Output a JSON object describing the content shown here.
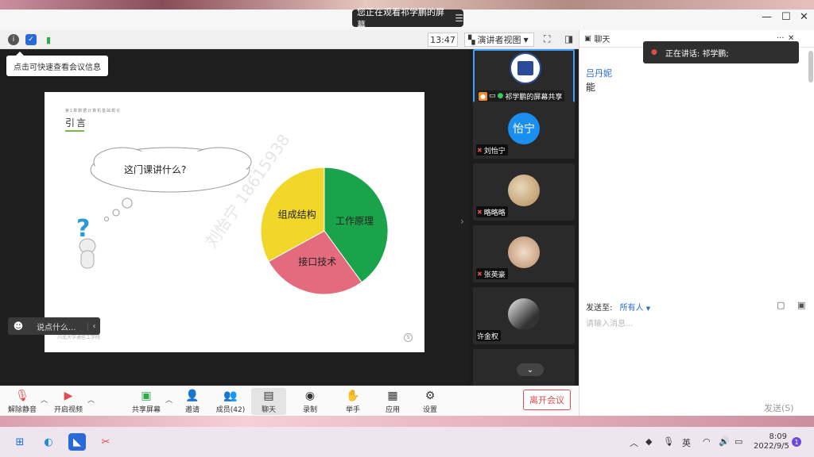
{
  "banner": {
    "text": "您正在观看祁学鹏的屏幕",
    "menu_icon": "menu-icon"
  },
  "toolbar": {
    "clock": "13:47",
    "view_label": "演讲者视图"
  },
  "tooltip": {
    "text": "点击可快速查看会议信息"
  },
  "slide": {
    "subtitle": "第1章数据计算机基础概论",
    "title": "引言",
    "cloud_text": "这门课讲什么?",
    "footer": "川北大学通信工学院",
    "page_number": "5",
    "watermark": "刘怡宁 18615938"
  },
  "chart_data": {
    "type": "pie",
    "categories": [
      "工作原理",
      "接口技术",
      "组成结构"
    ],
    "values": [
      40,
      27,
      33
    ],
    "colors": [
      "#1aa34a",
      "#e36b7d",
      "#f0d72a"
    ]
  },
  "say_bar": {
    "placeholder": "说点什么..."
  },
  "participants": [
    {
      "name": "祁学鹏的屏幕共享",
      "avatar": "logo"
    },
    {
      "name": "刘怡宁",
      "avatar_text": "怡宁"
    },
    {
      "name": "略略略",
      "avatar": "cartoon"
    },
    {
      "name": "张英豪",
      "avatar": "cat"
    },
    {
      "name": "许金权",
      "avatar": "photo"
    }
  ],
  "chat": {
    "title": "聊天",
    "speaking": "正在讲话: 祁学鹏;",
    "user": "吕丹妮",
    "message": "能",
    "send_to_label": "发送至:",
    "send_to_value": "所有人",
    "input_placeholder": "请输入消息...",
    "send_label": "发送(S)"
  },
  "controls": [
    {
      "label": "解除静音",
      "icon": "mic-muted-icon"
    },
    {
      "label": "开启视频",
      "icon": "video-off-icon"
    },
    {
      "label": "共享屏幕",
      "icon": "share-screen-icon"
    },
    {
      "label": "邀请",
      "icon": "invite-icon"
    },
    {
      "label": "成员(42)",
      "icon": "members-icon"
    },
    {
      "label": "聊天",
      "icon": "chat-icon"
    },
    {
      "label": "录制",
      "icon": "record-icon"
    },
    {
      "label": "举手",
      "icon": "hand-icon"
    },
    {
      "label": "应用",
      "icon": "apps-icon"
    },
    {
      "label": "设置",
      "icon": "settings-icon"
    }
  ],
  "leave_label": "离开会议",
  "taskbar": {
    "ime": "英",
    "time": "8:09",
    "date": "2022/9/5",
    "notifications": "1"
  }
}
